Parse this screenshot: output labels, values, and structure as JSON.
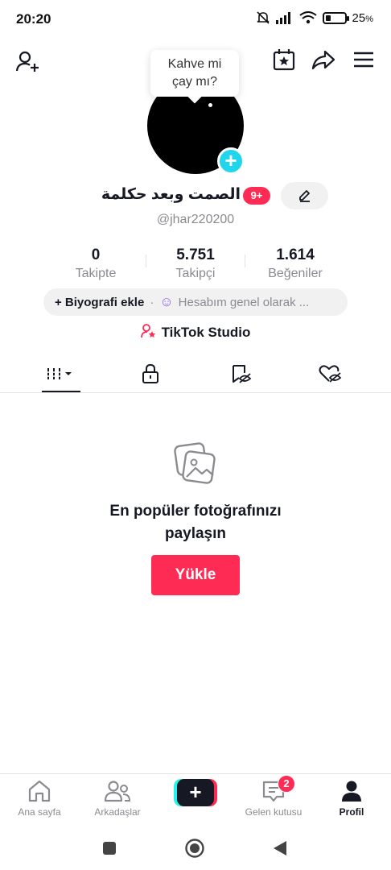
{
  "status_bar": {
    "time": "20:20",
    "battery_percent": "25",
    "battery_suffix": "%",
    "battery_level": 0.25
  },
  "topbar": {
    "add_friend_icon": "person-plus-icon",
    "calendar_icon": "calendar-star-icon",
    "share_icon": "share-arrow-icon",
    "menu_icon": "hamburger-menu-icon"
  },
  "tooltip": {
    "line1": "Kahve mi",
    "line2": "çay mı?"
  },
  "profile": {
    "display_name": "الصمت وبعد حكلمة",
    "badge": "9+",
    "handle": "@jhar220200"
  },
  "stats": [
    {
      "value": "0",
      "label": "Takipte"
    },
    {
      "value": "5.751",
      "label": "Takipçi"
    },
    {
      "value": "1.614",
      "label": "Beğeniler"
    }
  ],
  "bio": {
    "add_label": "+ Biyografi ekle",
    "separator": "·",
    "status_text": "Hesabım genel olarak ..."
  },
  "studio": {
    "label": "TikTok Studio"
  },
  "tabs": [
    {
      "name": "videos-grid",
      "icon": "grid-bars-icon",
      "active": true
    },
    {
      "name": "private",
      "icon": "lock-icon",
      "active": false
    },
    {
      "name": "reposts",
      "icon": "bookmark-eye-icon",
      "active": false
    },
    {
      "name": "liked",
      "icon": "heart-eye-icon",
      "active": false
    }
  ],
  "empty_state": {
    "icon": "photos-icon",
    "title_line1": "En popüler fotoğrafınızı",
    "title_line2": "paylaşın",
    "button": "Yükle"
  },
  "bottom_nav": {
    "home": "Ana sayfa",
    "friends": "Arkadaşlar",
    "create": "+",
    "inbox": "Gelen kutusu",
    "inbox_badge": "2",
    "profile": "Profil"
  },
  "colors": {
    "accent": "#fe2c55",
    "cyan": "#20d5ec",
    "muted": "#8a8b91"
  }
}
